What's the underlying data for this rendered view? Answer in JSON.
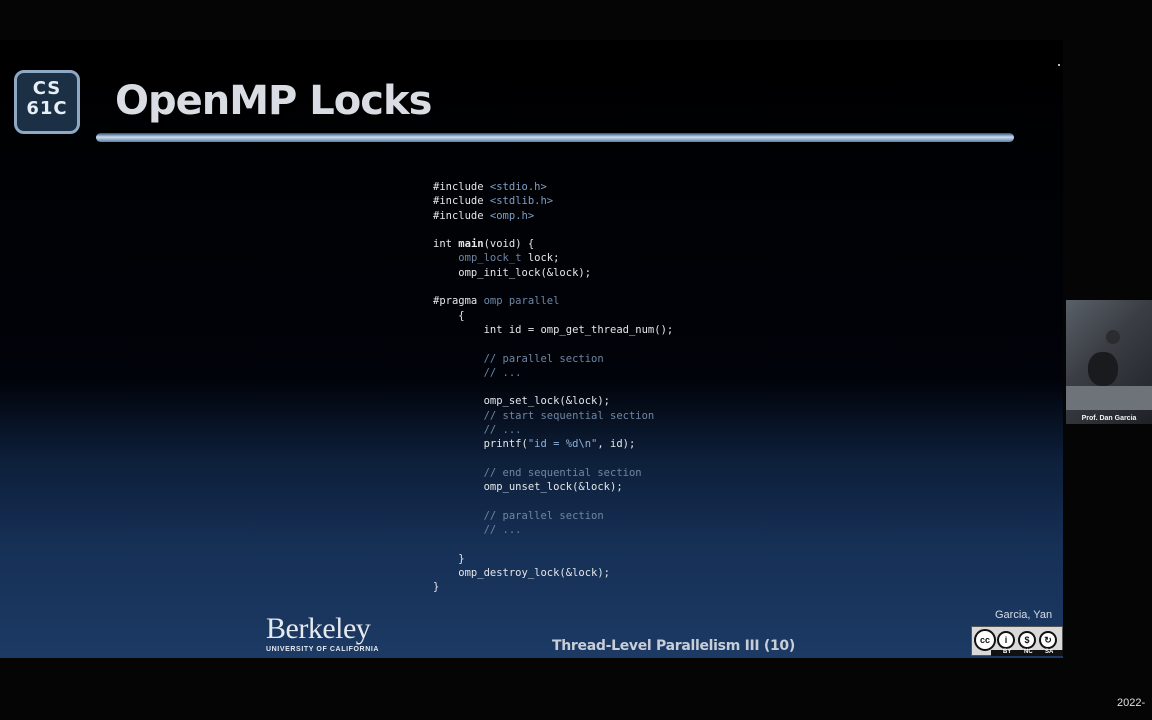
{
  "slide": {
    "logo_text_line1": "CS",
    "logo_text_line2": "61C",
    "title": "OpenMP Locks",
    "code_lines": [
      [
        {
          "t": "#include ",
          "c": "kw"
        },
        {
          "t": "<stdio.h>",
          "c": "inc"
        }
      ],
      [
        {
          "t": "#include ",
          "c": "kw"
        },
        {
          "t": "<stdlib.h>",
          "c": "inc"
        }
      ],
      [
        {
          "t": "#include ",
          "c": "kw"
        },
        {
          "t": "<omp.h>",
          "c": "inc"
        }
      ],
      [],
      [
        {
          "t": "int ",
          "c": "kw"
        },
        {
          "t": "main",
          "c": "bold"
        },
        {
          "t": "(void) {",
          "c": "kw"
        }
      ],
      [
        {
          "t": "    ",
          "c": "kw"
        },
        {
          "t": "omp_lock_t",
          "c": "cm"
        },
        {
          "t": " lock;",
          "c": "kw"
        }
      ],
      [
        {
          "t": "    omp_init_lock(&lock);",
          "c": "kw"
        }
      ],
      [],
      [
        {
          "t": "#pragma ",
          "c": "kw"
        },
        {
          "t": "omp parallel",
          "c": "cm"
        }
      ],
      [
        {
          "t": "    {",
          "c": "kw"
        }
      ],
      [
        {
          "t": "        int id = omp_get_thread_num();",
          "c": "kw"
        }
      ],
      [],
      [
        {
          "t": "        // parallel section",
          "c": "cm"
        }
      ],
      [
        {
          "t": "        // ...",
          "c": "cm"
        }
      ],
      [],
      [
        {
          "t": "        omp_set_lock(&lock);",
          "c": "kw"
        }
      ],
      [
        {
          "t": "        // start sequential section",
          "c": "cm"
        }
      ],
      [
        {
          "t": "        // ...",
          "c": "cm"
        }
      ],
      [
        {
          "t": "        printf(",
          "c": "kw"
        },
        {
          "t": "\"id = %d\\n\"",
          "c": "str"
        },
        {
          "t": ", id);",
          "c": "kw"
        }
      ],
      [],
      [
        {
          "t": "        // end sequential section",
          "c": "cm"
        }
      ],
      [
        {
          "t": "        omp_unset_lock(&lock);",
          "c": "kw"
        }
      ],
      [],
      [
        {
          "t": "        // parallel section",
          "c": "cm"
        }
      ],
      [
        {
          "t": "        // ...",
          "c": "cm"
        }
      ],
      [],
      [
        {
          "t": "    }",
          "c": "kw"
        }
      ],
      [
        {
          "t": "    omp_destroy_lock(&lock);",
          "c": "kw"
        }
      ],
      [
        {
          "t": "}",
          "c": "kw"
        }
      ]
    ],
    "berkeley_word": "Berkeley",
    "berkeley_sub": "UNIVERSITY OF CALIFORNIA",
    "footer_title": "Thread-Level Parallelism III (10)",
    "authors": "Garcia, Yan",
    "license": {
      "labels": [
        "BY",
        "NC",
        "SA"
      ]
    }
  },
  "webcam": {
    "label": "Prof. Dan Garcia"
  },
  "date_fragment": "2022-"
}
